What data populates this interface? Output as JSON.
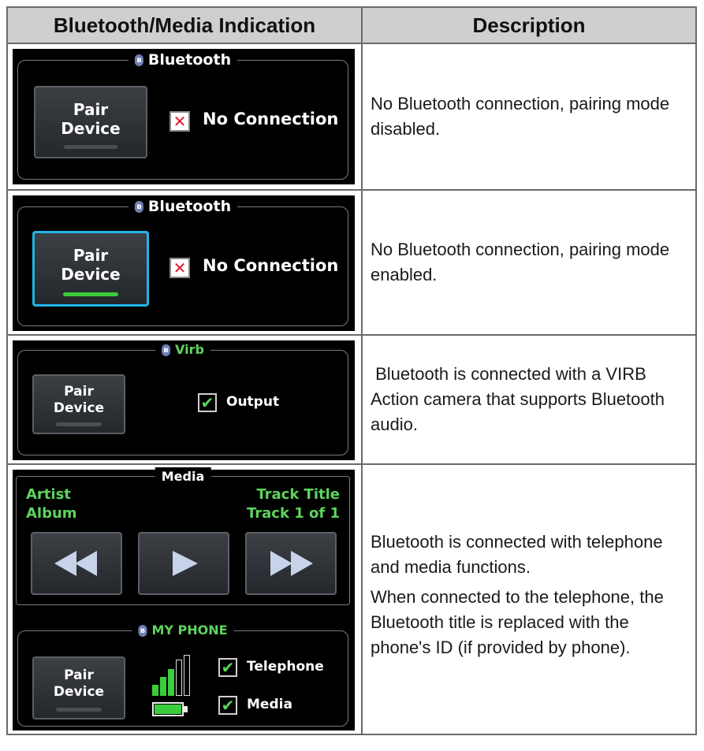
{
  "header": {
    "col1": "Bluetooth/Media Indication",
    "col2": "Description"
  },
  "rows": [
    {
      "panel": {
        "title_icon": "bluetooth-icon",
        "title": "Bluetooth",
        "pair_button": [
          "Pair",
          "Device"
        ],
        "pair_active": false,
        "status_icon": "x-mark-icon",
        "status": "No Connection"
      },
      "description": [
        "No Bluetooth connection, pairing mode disabled."
      ]
    },
    {
      "panel": {
        "title_icon": "bluetooth-icon",
        "title": "Bluetooth",
        "pair_button": [
          "Pair",
          "Device"
        ],
        "pair_active": true,
        "status_icon": "x-mark-icon",
        "status": "No Connection"
      },
      "description": [
        "No Bluetooth connection, pairing mode enabled."
      ]
    },
    {
      "panel": {
        "title_icon": "bluetooth-icon",
        "title": "Virb",
        "pair_button": [
          "Pair",
          "Device"
        ],
        "pair_active": false,
        "status_icon": "checkmark-icon",
        "status": "Output"
      },
      "description": [
        " Bluetooth is connected with a VIRB Action camera that supports Bluetooth audio."
      ]
    },
    {
      "media": {
        "title": "Media",
        "artist": "Artist",
        "album": "Album",
        "track_title": "Track Title",
        "track_num": "Track 1 of 1",
        "buttons": [
          "rewind-icon",
          "play-icon",
          "fast-forward-icon"
        ]
      },
      "phone": {
        "title_icon": "bluetooth-icon",
        "title": "MY PHONE",
        "pair_button": [
          "Pair",
          "Device"
        ],
        "signal_icon": "signal-bars-icon",
        "battery_icon": "battery-icon",
        "options": [
          "Telephone",
          "Media"
        ]
      },
      "description": [
        "Bluetooth is connected with telephone and media functions.",
        "When connected to the telephone, the Bluetooth title is replaced with the phone's ID (if provided by phone)."
      ]
    }
  ]
}
